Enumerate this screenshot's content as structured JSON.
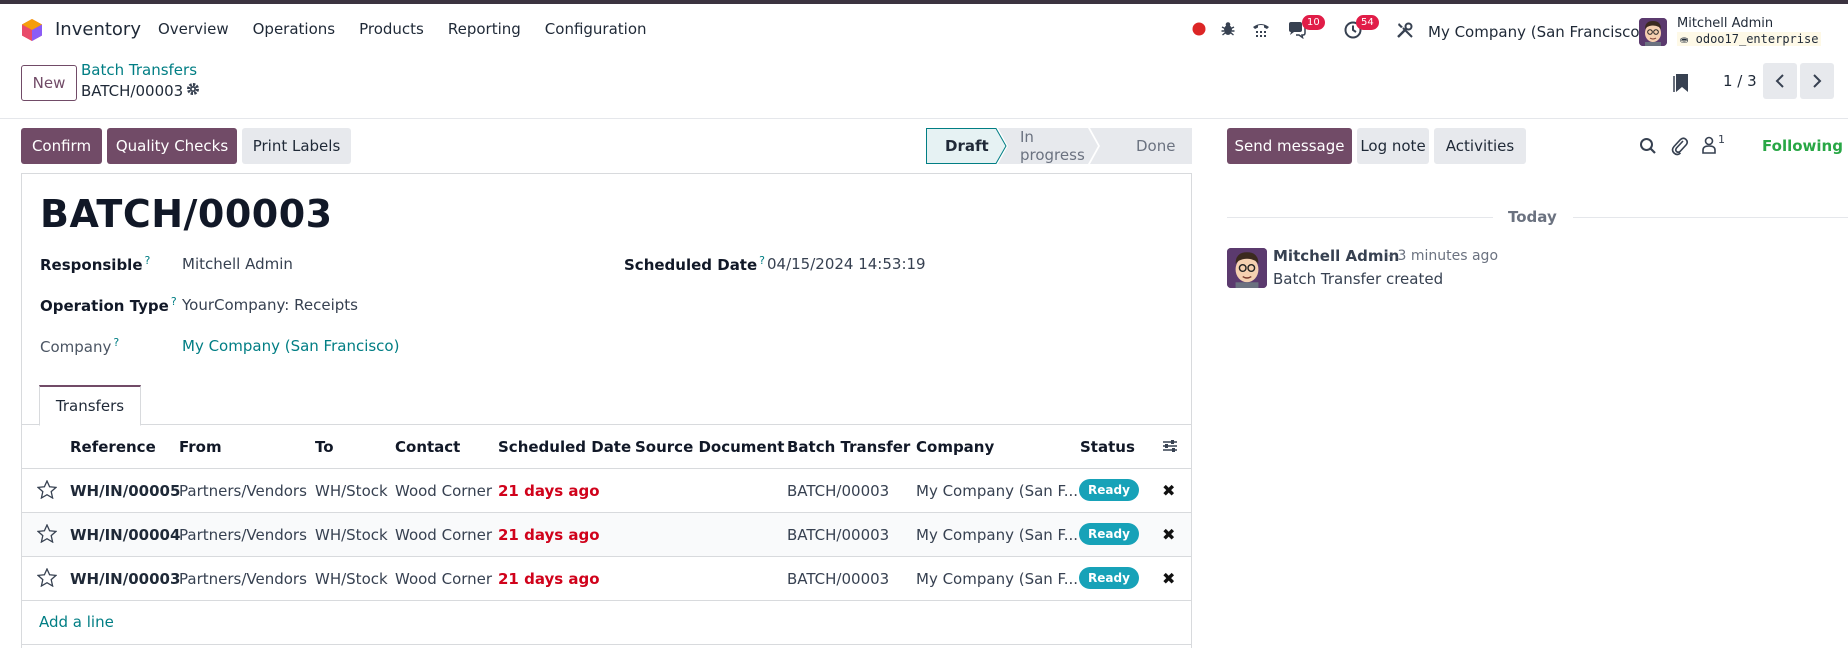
{
  "app": {
    "name": "Inventory"
  },
  "menu": [
    "Overview",
    "Operations",
    "Products",
    "Reporting",
    "Configuration"
  ],
  "systray": {
    "messages_count": "10",
    "activities_count": "54",
    "company": "My Company (San Francisco)",
    "user_name": "Mitchell Admin",
    "database": "odoo17_enterprise"
  },
  "control": {
    "new_label": "New",
    "breadcrumb_parent": "Batch Transfers",
    "breadcrumb_current": "BATCH/00003",
    "pager": "1 / 3"
  },
  "actions": {
    "confirm": "Confirm",
    "quality_checks": "Quality Checks",
    "print_labels": "Print Labels"
  },
  "status": {
    "stages": [
      "Draft",
      "In progress",
      "Done"
    ],
    "current": "Draft"
  },
  "form": {
    "title": "BATCH/00003",
    "responsible_label": "Responsible",
    "responsible_value": "Mitchell Admin",
    "scheduled_label": "Scheduled Date",
    "scheduled_value": "04/15/2024 14:53:19",
    "operation_label": "Operation Type",
    "operation_value": "YourCompany: Receipts",
    "company_label": "Company",
    "company_value": "My Company (San Francisco)",
    "help_mark": "?"
  },
  "tabs": {
    "transfers": "Transfers"
  },
  "table": {
    "headers": [
      "Reference",
      "From",
      "To",
      "Contact",
      "Scheduled Date",
      "Source Document",
      "Batch Transfer",
      "Company",
      "Status"
    ],
    "rows": [
      {
        "reference": "WH/IN/00005",
        "from": "Partners/Vendors",
        "to": "WH/Stock",
        "contact": "Wood Corner",
        "scheduled": "21 days ago",
        "source": "",
        "batch": "BATCH/00003",
        "company": "My Company (San F...",
        "status": "Ready"
      },
      {
        "reference": "WH/IN/00004",
        "from": "Partners/Vendors",
        "to": "WH/Stock",
        "contact": "Wood Corner",
        "scheduled": "21 days ago",
        "source": "",
        "batch": "BATCH/00003",
        "company": "My Company (San F...",
        "status": "Ready"
      },
      {
        "reference": "WH/IN/00003",
        "from": "Partners/Vendors",
        "to": "WH/Stock",
        "contact": "Wood Corner",
        "scheduled": "21 days ago",
        "source": "",
        "batch": "BATCH/00003",
        "company": "My Company (San F...",
        "status": "Ready"
      }
    ],
    "add_line": "Add a line"
  },
  "chatter": {
    "send_message": "Send message",
    "log_note": "Log note",
    "activities": "Activities",
    "followers_count": "1",
    "following": "Following",
    "today": "Today",
    "message": {
      "author": "Mitchell Admin",
      "time": "- 3 minutes ago",
      "body": "Batch Transfer created"
    }
  },
  "colors": {
    "primary": "#714b67",
    "link": "#017e84",
    "ready_badge": "#17a2b8",
    "overdue": "#d0021b",
    "following": "#28a745",
    "badge": "#e11d48"
  }
}
